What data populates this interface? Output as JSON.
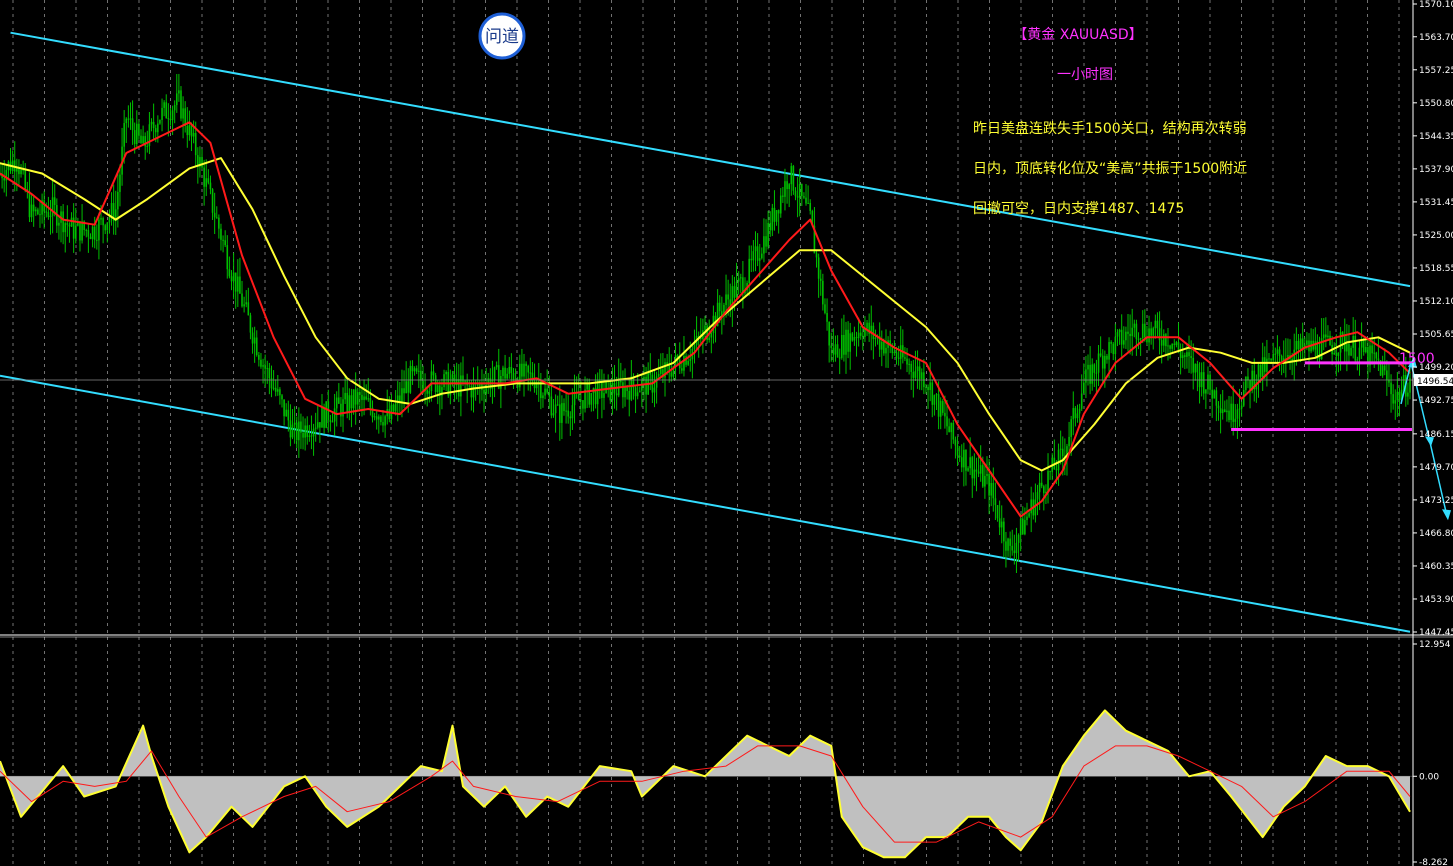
{
  "logo": {
    "text": "问道",
    "border_color": "#1e5fd6"
  },
  "annotations": {
    "title": "【黄金 XAUUASD】",
    "timeframe": "一小时图",
    "notes": [
      "昨日美盘连跌失手1500关口，结构再次转弱",
      "日内，顶底转化位及“美高”共振于1500附近",
      "回撤可空，日内支撑1487、1475"
    ],
    "level_label": "1500"
  },
  "colors": {
    "background": "#000000",
    "bull_candle": "#00c000",
    "bear_candle": "#00c000",
    "ma_fast": "#ff1a1a",
    "ma_slow": "#ffff33",
    "channel": "#33ddff",
    "level_line": "#ff33ff",
    "grid": "#ffffff",
    "macd_fill": "#c0c0c0",
    "macd_line": "#ffff33",
    "macd_signal": "#ff1a1a"
  },
  "chart_data": [
    {
      "type": "candlestick",
      "title": "【黄金 XAUUASD】 一小时图",
      "y_ticks": [
        "1570.10",
        "1563.70",
        "1557.25",
        "1550.80",
        "1544.35",
        "1537.90",
        "1531.45",
        "1525.00",
        "1518.55",
        "1512.10",
        "1505.65",
        "1499.20",
        "1492.75",
        "1486.15",
        "1479.70",
        "1473.25",
        "1466.80",
        "1460.35",
        "1453.90",
        "1447.45"
      ],
      "ylim": [
        1447.45,
        1570.1
      ],
      "current_price": "1496.54",
      "current_price_value": 1496.54,
      "grid": "vertical-dotted",
      "close_path": [
        [
          0,
          1537
        ],
        [
          8,
          1540
        ],
        [
          15,
          1529
        ],
        [
          25,
          1530
        ],
        [
          35,
          1526
        ],
        [
          45,
          1526
        ],
        [
          55,
          1530
        ],
        [
          60,
          1548
        ],
        [
          68,
          1542
        ],
        [
          75,
          1548
        ],
        [
          85,
          1551
        ],
        [
          95,
          1539
        ],
        [
          110,
          1518
        ],
        [
          125,
          1500
        ],
        [
          140,
          1486
        ],
        [
          155,
          1490
        ],
        [
          170,
          1493
        ],
        [
          185,
          1489
        ],
        [
          195,
          1497
        ],
        [
          210,
          1496
        ],
        [
          225,
          1495
        ],
        [
          240,
          1498
        ],
        [
          255,
          1497
        ],
        [
          265,
          1490
        ],
        [
          280,
          1494
        ],
        [
          295,
          1495
        ],
        [
          310,
          1496
        ],
        [
          330,
          1503
        ],
        [
          345,
          1512
        ],
        [
          355,
          1517
        ],
        [
          365,
          1526
        ],
        [
          375,
          1537
        ],
        [
          385,
          1528
        ],
        [
          395,
          1502
        ],
        [
          410,
          1507
        ],
        [
          425,
          1502
        ],
        [
          440,
          1497
        ],
        [
          455,
          1483
        ],
        [
          470,
          1476
        ],
        [
          480,
          1463
        ],
        [
          488,
          1470
        ],
        [
          495,
          1476
        ],
        [
          505,
          1482
        ],
        [
          515,
          1496
        ],
        [
          525,
          1502
        ],
        [
          540,
          1507
        ],
        [
          555,
          1505
        ],
        [
          565,
          1500
        ],
        [
          575,
          1495
        ],
        [
          585,
          1490
        ],
        [
          595,
          1497
        ],
        [
          610,
          1502
        ],
        [
          625,
          1503
        ],
        [
          640,
          1504
        ],
        [
          655,
          1500
        ],
        [
          663,
          1493
        ],
        [
          670,
          1497
        ]
      ],
      "ma_fast_path": [
        [
          0,
          1537
        ],
        [
          15,
          1533
        ],
        [
          30,
          1528
        ],
        [
          45,
          1527
        ],
        [
          60,
          1541
        ],
        [
          75,
          1544
        ],
        [
          90,
          1547
        ],
        [
          100,
          1543
        ],
        [
          115,
          1521
        ],
        [
          130,
          1505
        ],
        [
          145,
          1493
        ],
        [
          160,
          1490
        ],
        [
          175,
          1491
        ],
        [
          190,
          1490
        ],
        [
          205,
          1496
        ],
        [
          220,
          1496
        ],
        [
          240,
          1496
        ],
        [
          255,
          1497
        ],
        [
          270,
          1494
        ],
        [
          290,
          1495
        ],
        [
          310,
          1496
        ],
        [
          330,
          1502
        ],
        [
          345,
          1510
        ],
        [
          360,
          1517
        ],
        [
          375,
          1524
        ],
        [
          385,
          1528
        ],
        [
          395,
          1518
        ],
        [
          410,
          1507
        ],
        [
          425,
          1503
        ],
        [
          440,
          1500
        ],
        [
          455,
          1488
        ],
        [
          470,
          1479
        ],
        [
          485,
          1470
        ],
        [
          495,
          1473
        ],
        [
          505,
          1479
        ],
        [
          515,
          1490
        ],
        [
          530,
          1500
        ],
        [
          545,
          1505
        ],
        [
          560,
          1505
        ],
        [
          575,
          1500
        ],
        [
          590,
          1493
        ],
        [
          605,
          1499
        ],
        [
          620,
          1503
        ],
        [
          635,
          1505
        ],
        [
          645,
          1506
        ],
        [
          660,
          1502
        ],
        [
          670,
          1498
        ]
      ],
      "ma_slow_path": [
        [
          0,
          1539
        ],
        [
          20,
          1537
        ],
        [
          40,
          1532
        ],
        [
          55,
          1528
        ],
        [
          70,
          1532
        ],
        [
          90,
          1538
        ],
        [
          105,
          1540
        ],
        [
          120,
          1530
        ],
        [
          135,
          1517
        ],
        [
          150,
          1505
        ],
        [
          165,
          1497
        ],
        [
          180,
          1493
        ],
        [
          195,
          1492
        ],
        [
          210,
          1494
        ],
        [
          225,
          1495
        ],
        [
          245,
          1496
        ],
        [
          260,
          1496
        ],
        [
          280,
          1496
        ],
        [
          300,
          1497
        ],
        [
          320,
          1500
        ],
        [
          340,
          1508
        ],
        [
          360,
          1515
        ],
        [
          380,
          1522
        ],
        [
          395,
          1522
        ],
        [
          410,
          1517
        ],
        [
          425,
          1512
        ],
        [
          440,
          1507
        ],
        [
          455,
          1500
        ],
        [
          470,
          1490
        ],
        [
          485,
          1481
        ],
        [
          495,
          1479
        ],
        [
          505,
          1481
        ],
        [
          520,
          1488
        ],
        [
          535,
          1496
        ],
        [
          550,
          1501
        ],
        [
          565,
          1503
        ],
        [
          580,
          1502
        ],
        [
          595,
          1500
        ],
        [
          610,
          1500
        ],
        [
          625,
          1501
        ],
        [
          640,
          1504
        ],
        [
          655,
          1505
        ],
        [
          670,
          1502
        ]
      ],
      "channel_upper": [
        [
          5,
          1564.5
        ],
        [
          670,
          1515.0
        ]
      ],
      "channel_lower": [
        [
          0,
          1497.5
        ],
        [
          670,
          1447.5
        ]
      ],
      "levels": [
        {
          "value": 1500,
          "x_from": 620,
          "x_to": 670
        },
        {
          "value": 1487,
          "x_from": 585,
          "x_to": 670
        }
      ],
      "x_range": [
        0,
        670
      ]
    },
    {
      "type": "area",
      "title": "MACD",
      "y_ticks": [
        "12.954",
        "0.00",
        "-8.262"
      ],
      "ylim": [
        -8.262,
        12.954
      ],
      "macd_path": [
        [
          0,
          1.5
        ],
        [
          10,
          -4
        ],
        [
          18,
          -2
        ],
        [
          30,
          1
        ],
        [
          40,
          -2
        ],
        [
          55,
          -1
        ],
        [
          68,
          5
        ],
        [
          72,
          2
        ],
        [
          80,
          -3
        ],
        [
          90,
          -7.5
        ],
        [
          98,
          -6
        ],
        [
          110,
          -3
        ],
        [
          120,
          -5
        ],
        [
          135,
          -1
        ],
        [
          145,
          0
        ],
        [
          155,
          -3
        ],
        [
          165,
          -5
        ],
        [
          180,
          -3
        ],
        [
          190,
          -1
        ],
        [
          200,
          1
        ],
        [
          210,
          0.5
        ],
        [
          215,
          5
        ],
        [
          220,
          -1
        ],
        [
          230,
          -3
        ],
        [
          240,
          -1
        ],
        [
          250,
          -4
        ],
        [
          260,
          -2
        ],
        [
          270,
          -3
        ],
        [
          285,
          1
        ],
        [
          300,
          0.5
        ],
        [
          305,
          -2
        ],
        [
          310,
          -1
        ],
        [
          320,
          1
        ],
        [
          335,
          0
        ],
        [
          345,
          2
        ],
        [
          355,
          4
        ],
        [
          365,
          3
        ],
        [
          375,
          2
        ],
        [
          385,
          4
        ],
        [
          395,
          3
        ],
        [
          400,
          -4
        ],
        [
          410,
          -7
        ],
        [
          420,
          -8
        ],
        [
          430,
          -8
        ],
        [
          440,
          -6
        ],
        [
          450,
          -6
        ],
        [
          460,
          -4
        ],
        [
          470,
          -4
        ],
        [
          478,
          -6
        ],
        [
          485,
          -7.3
        ],
        [
          495,
          -4.5
        ],
        [
          505,
          1
        ],
        [
          515,
          4
        ],
        [
          525,
          6.5
        ],
        [
          535,
          4.5
        ],
        [
          545,
          3.5
        ],
        [
          555,
          2.5
        ],
        [
          565,
          0
        ],
        [
          575,
          0.5
        ],
        [
          585,
          -2
        ],
        [
          600,
          -6
        ],
        [
          610,
          -3
        ],
        [
          620,
          -1
        ],
        [
          630,
          2
        ],
        [
          640,
          1
        ],
        [
          650,
          1
        ],
        [
          660,
          0
        ],
        [
          670,
          -3.5
        ]
      ],
      "signal_path": [
        [
          0,
          0.5
        ],
        [
          15,
          -2.5
        ],
        [
          30,
          -0.5
        ],
        [
          45,
          -1
        ],
        [
          60,
          -0.5
        ],
        [
          72,
          2.5
        ],
        [
          85,
          -2
        ],
        [
          98,
          -6
        ],
        [
          115,
          -4
        ],
        [
          135,
          -2
        ],
        [
          150,
          -1
        ],
        [
          165,
          -3.5
        ],
        [
          185,
          -2.5
        ],
        [
          205,
          0
        ],
        [
          215,
          1.5
        ],
        [
          225,
          -1
        ],
        [
          245,
          -2
        ],
        [
          265,
          -2.5
        ],
        [
          285,
          -0.5
        ],
        [
          305,
          -0.5
        ],
        [
          325,
          0.5
        ],
        [
          345,
          1
        ],
        [
          360,
          3
        ],
        [
          380,
          3
        ],
        [
          395,
          2
        ],
        [
          410,
          -3
        ],
        [
          425,
          -6.5
        ],
        [
          445,
          -6.5
        ],
        [
          465,
          -4.5
        ],
        [
          485,
          -6
        ],
        [
          500,
          -4
        ],
        [
          515,
          1
        ],
        [
          530,
          3
        ],
        [
          545,
          3
        ],
        [
          560,
          2
        ],
        [
          575,
          0.5
        ],
        [
          590,
          -1
        ],
        [
          605,
          -4
        ],
        [
          620,
          -2.5
        ],
        [
          640,
          0.5
        ],
        [
          660,
          0.5
        ],
        [
          670,
          -2
        ]
      ],
      "x_range": [
        0,
        670
      ]
    }
  ]
}
